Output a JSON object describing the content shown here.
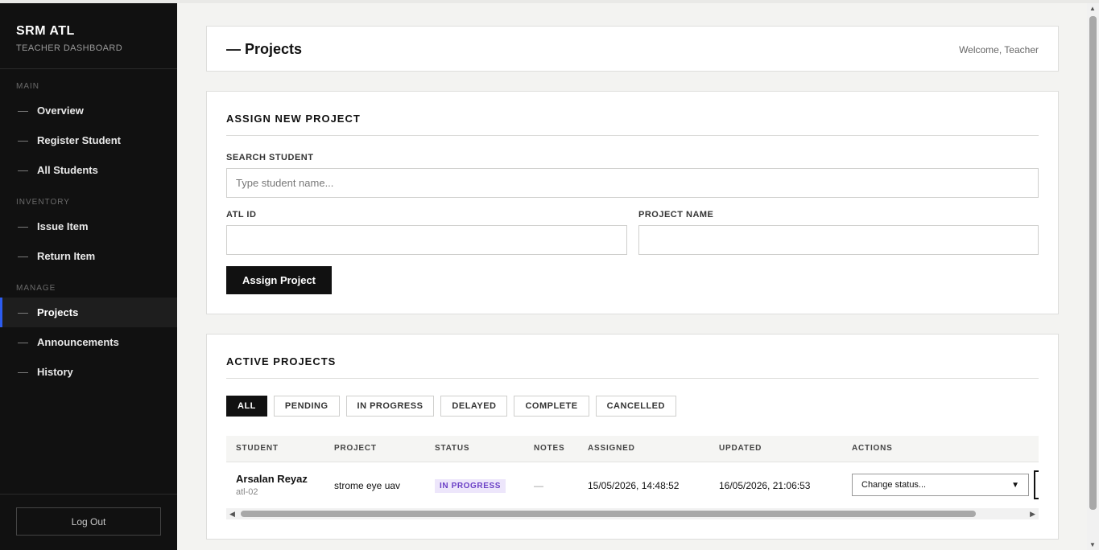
{
  "brand": {
    "title": "SRM ATL",
    "subtitle": "TEACHER DASHBOARD"
  },
  "nav": {
    "sections": [
      {
        "label": "MAIN",
        "items": [
          "Overview",
          "Register Student",
          "All Students"
        ]
      },
      {
        "label": "INVENTORY",
        "items": [
          "Issue Item",
          "Return Item"
        ]
      },
      {
        "label": "MANAGE",
        "items": [
          "Projects",
          "Announcements",
          "History"
        ]
      }
    ],
    "active": "Projects",
    "dash": "—",
    "logout": "Log Out"
  },
  "header": {
    "title": "— Projects",
    "welcome": "Welcome, Teacher"
  },
  "assign": {
    "title": "ASSIGN NEW PROJECT",
    "search_label": "SEARCH STUDENT",
    "search_placeholder": "Type student name...",
    "atl_label": "ATL ID",
    "atl_value": "",
    "project_label": "PROJECT NAME",
    "project_value": "",
    "button": "Assign Project"
  },
  "active_projects": {
    "title": "ACTIVE PROJECTS",
    "filters": [
      "ALL",
      "PENDING",
      "IN PROGRESS",
      "DELAYED",
      "COMPLETE",
      "CANCELLED"
    ],
    "active_filter": "ALL",
    "columns": [
      "STUDENT",
      "PROJECT",
      "STATUS",
      "NOTES",
      "ASSIGNED",
      "UPDATED",
      "ACTIONS"
    ],
    "rows": [
      {
        "student": "Arsalan Reyaz",
        "atl_id": "atl-02",
        "project": "strome eye uav",
        "status": "IN PROGRESS",
        "notes": "—",
        "assigned": "15/05/2026, 14:48:52",
        "updated": "16/05/2026, 21:06:53",
        "action": "Change status..."
      }
    ]
  },
  "colors": {
    "sidebar_bg": "#111111",
    "active_accent": "#2c5cf0",
    "badge_bg": "#ede6fb",
    "badge_text": "#6a3fc5"
  },
  "icons": {
    "select_chevron": "chevron-down-icon",
    "scroll_left": "arrow-left-icon",
    "scroll_right": "arrow-right-icon"
  }
}
